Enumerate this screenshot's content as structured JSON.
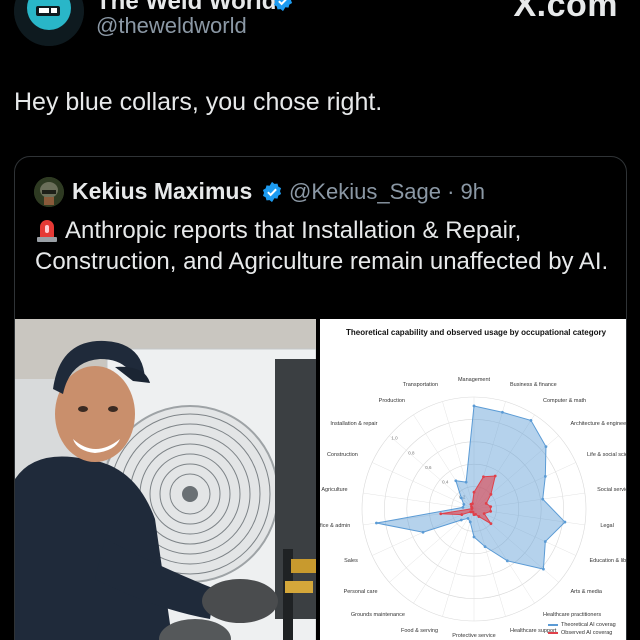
{
  "app": {
    "brand": "X.com"
  },
  "author": {
    "display_name": "The Weld World",
    "handle": "@theweldworld",
    "avatar_icon": "welder-mask-icon",
    "verified_icon": "verified-badge-icon"
  },
  "post": {
    "text": "Hey blue collars, you chose right."
  },
  "quote": {
    "display_name": "Kekius Maximus",
    "handle_time": "@Kekius_Sage · 9h",
    "verified_icon": "verified-badge-icon",
    "siren_icon": "siren-emoji-icon",
    "text": "Anthropic reports that Installation & Repair, Construction, and Agriculture remain unaffected by AI."
  },
  "media": {
    "left_photo": "technician-repairing-air-conditioner-photo",
    "chart": {
      "title": "Theoretical capability and observed usage by occupational category",
      "categories": [
        "Management",
        "Business & finance",
        "Computer & math",
        "Architecture & enginee",
        "Life & social scie",
        "Social servic",
        "Legal",
        "Education & libr",
        "Arts & media",
        "Healthcare practitioners",
        "Healthcare support",
        "Protective service",
        "Food & serving",
        "Grounds maintenance",
        "Personal care",
        "Sales",
        "fice & admin",
        "Agriculture",
        "Construction",
        "Installation & repair",
        "Production",
        "Transportation"
      ],
      "legend": [
        "Theoretical AI coverag",
        "Observed AI coverag"
      ],
      "ring_labels": [
        "1.0",
        "0.8",
        "0.6",
        "0.4",
        "0.2"
      ],
      "colors": {
        "theoretical": "#5b9bd5",
        "observed": "#e0404a"
      }
    }
  },
  "chart_data": {
    "type": "radar",
    "title": "Theoretical capability and observed usage by occupational category",
    "categories": [
      "Management",
      "Business & finance",
      "Computer & math",
      "Architecture & enginee",
      "Life & social scie",
      "Social servic",
      "Legal",
      "Education & libr",
      "Arts & media",
      "Healthcare practitioners",
      "Healthcare support",
      "Protective service",
      "Food & serving",
      "Grounds maintenance",
      "Personal care",
      "Sales",
      "fice & admin",
      "Agriculture",
      "Construction",
      "Installation & repair",
      "Production",
      "Transportation"
    ],
    "series": [
      {
        "name": "Theoretical AI coverag",
        "values": [
          0.92,
          0.9,
          0.94,
          0.85,
          0.7,
          0.62,
          0.82,
          0.7,
          0.82,
          0.55,
          0.35,
          0.25,
          0.12,
          0.1,
          0.15,
          0.5,
          0.88,
          0.1,
          0.1,
          0.15,
          0.3,
          0.25
        ]
      },
      {
        "name": "Observed AI coverag",
        "values": [
          0.15,
          0.3,
          0.35,
          0.2,
          0.12,
          0.15,
          0.15,
          0.1,
          0.2,
          0.08,
          0.05,
          0.05,
          0.03,
          0.03,
          0.04,
          0.12,
          0.3,
          0.02,
          0.02,
          0.03,
          0.05,
          0.05
        ]
      }
    ],
    "rlim": [
      0,
      1
    ],
    "legend_position": "bottom-right"
  }
}
